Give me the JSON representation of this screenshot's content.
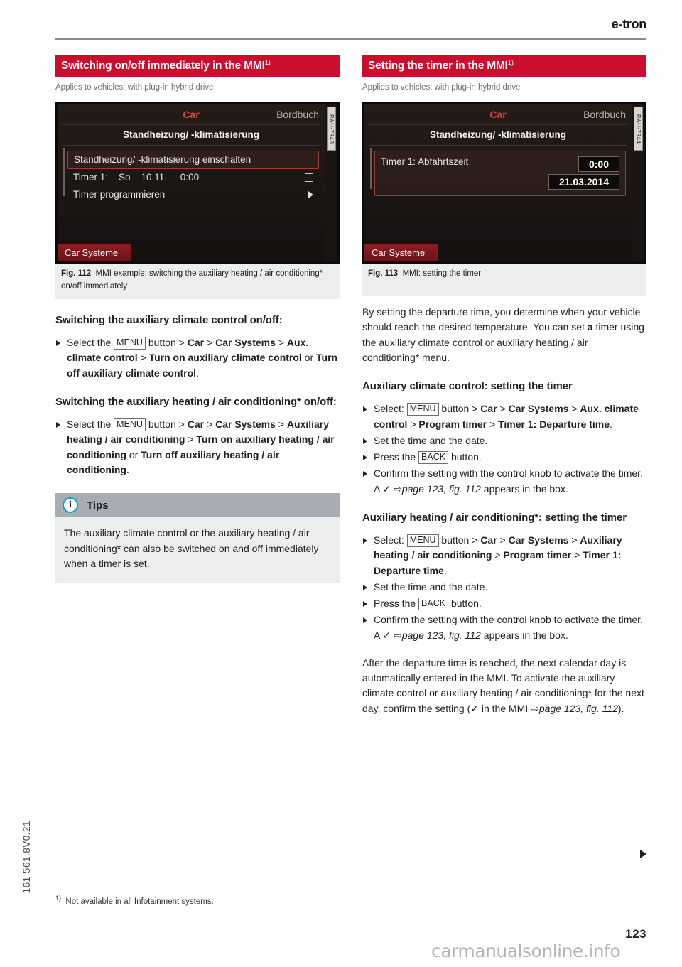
{
  "header": {
    "brand": "e-tron"
  },
  "left": {
    "section_title": "Switching on/off immediately in the MMI",
    "section_title_sup": "1)",
    "applies_note": "Applies to vehicles: with plug-in hybrid drive",
    "mmi": {
      "top_center": "Car",
      "top_right": "Bordbuch",
      "subtitle": "Standheizung/ -klimatisierung",
      "side_code": "RAH-7943",
      "rows": [
        {
          "label": "Standheizung/ -klimatisierung einschalten",
          "control": "none",
          "selected": true
        },
        {
          "label": "Timer 1:    So    10.11.     0:00",
          "control": "checkbox",
          "selected": false
        },
        {
          "label": "Timer programmieren",
          "control": "arrow",
          "selected": false
        }
      ],
      "tab": "Car Systeme"
    },
    "fig_label": "Fig. 112",
    "fig_caption": "MMI example: switching the auxiliary heating / air conditioning* on/off immediately",
    "head1": "Switching the auxiliary climate control on/off:",
    "step1": {
      "t1": "Select the ",
      "kbd": "MENU",
      "t2": " button > ",
      "b1": "Car",
      "t3": " > ",
      "b2": "Car Systems",
      "t4": " > ",
      "b3": "Aux. climate control",
      "t5": " > ",
      "b4": "Turn on auxiliary climate control",
      "t6": " or ",
      "b5": "Turn off auxiliary climate control",
      "t7": "."
    },
    "head2": "Switching the auxiliary heating / air conditioning* on/off:",
    "step2": {
      "t1": "Select the ",
      "kbd": "MENU",
      "t2": " button > ",
      "b1": "Car",
      "t3": " > ",
      "b2": "Car Systems",
      "t4": " > ",
      "b3": "Auxiliary heating / air conditioning",
      "t5": " > ",
      "b4": "Turn on auxiliary heating / air conditioning",
      "t6": " or ",
      "b5": "Turn off auxiliary heating / air conditioning",
      "t7": "."
    },
    "tips": {
      "icon": "info-icon",
      "title": "Tips",
      "body": "The auxiliary climate control or the auxiliary heating / air conditioning* can also be switched on and off immediately when a timer is set."
    }
  },
  "right": {
    "section_title": "Setting the timer in the MMI",
    "section_title_sup": "1)",
    "applies_note": "Applies to vehicles: with plug-in hybrid drive",
    "mmi": {
      "top_center": "Car",
      "top_right": "Bordbuch",
      "subtitle": "Standheizung/ -klimatisierung",
      "side_code": "RAH-7944",
      "row_label": "Timer 1: Abfahrtszeit",
      "value_time": "0:00",
      "value_date": "21.03.2014",
      "tab": "Car Systeme"
    },
    "fig_label": "Fig. 113",
    "fig_caption": "MMI: setting the timer",
    "intro": {
      "t1": "By setting the departure time, you determine when your vehicle should reach the desired temperature. You can set ",
      "b1": "a",
      "t2": " timer using the auxiliary climate control or auxiliary heating / air conditioning* menu."
    },
    "head1": "Auxiliary climate control: setting the timer",
    "step1": {
      "t1": "Select: ",
      "kbd": "MENU",
      "t2": " button > ",
      "b1": "Car",
      "t3": " > ",
      "b2": "Car Systems",
      "t4": " > ",
      "b3": "Aux. climate control",
      "t5": " > ",
      "b4": "Program timer",
      "t6": " > ",
      "b5": "Timer 1: Departure time",
      "t7": "."
    },
    "step2": "Set the time and the date.",
    "step3": {
      "t1": "Press the ",
      "kbd": "BACK",
      "t2": " button."
    },
    "step4": {
      "t1": "Confirm the setting with the control knob to activate the timer. A ",
      "check": "✓",
      "t2": " ",
      "arrow": "⇨",
      "ref": "page 123, fig. 112",
      "t3": " appears in the box."
    },
    "head2": "Auxiliary heating / air conditioning*: setting the timer",
    "step5": {
      "t1": "Select: ",
      "kbd": "MENU",
      "t2": " button > ",
      "b1": "Car",
      "t3": " > ",
      "b2": "Car Systems",
      "t4": " > ",
      "b3": "Auxiliary heating / air conditioning",
      "t5": " > ",
      "b4": "Program timer",
      "t6": " > ",
      "b5": "Timer 1: Departure time",
      "t7": "."
    },
    "step6": "Set the time and the date.",
    "step7": {
      "t1": "Press the ",
      "kbd": "BACK",
      "t2": " button."
    },
    "step8": {
      "t1": "Confirm the setting with the control knob to activate the timer. A ",
      "check": "✓",
      "t2": " ",
      "arrow": "⇨",
      "ref": "page 123, fig. 112",
      "t3": " appears in the box."
    },
    "outro": {
      "t1": "After the departure time is reached, the next calendar day is automatically entered in the MMI. To activate the auxiliary climate control or auxiliary heating / air conditioning* for the next day, confirm the setting (",
      "check": "✓",
      "t2": " in the MMI ",
      "arrow": "⇨",
      "ref": "page 123, fig. 112",
      "t3": ")."
    }
  },
  "footer": {
    "doc_code": "161.561.8V0.21",
    "footnote_marker": "1)",
    "footnote": "Not available in all Infotainment systems.",
    "page_number": "123",
    "watermark": "carmanualsonline.info"
  },
  "colors": {
    "accent_red": "#cc0e2e",
    "caption_bg": "#eceded",
    "tips_head_bg": "#a7adb2",
    "info_ring": "#00a3c7"
  }
}
